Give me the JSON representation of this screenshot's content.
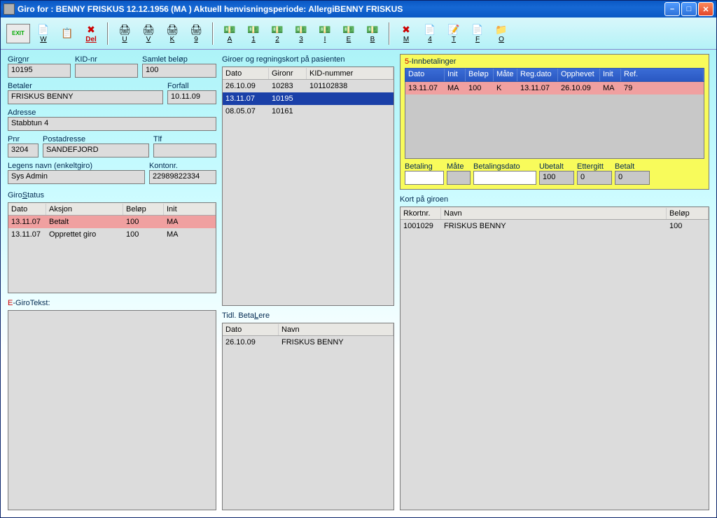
{
  "title": "Giro for :   BENNY FRISKUS 12.12.1956 (MA  )   Aktuell henvisningsperiode: AllergiBENNY FRISKUS",
  "toolbar": {
    "exit": "EXIT",
    "items": [
      "W",
      "",
      "Del",
      "U",
      "V",
      "K",
      "9",
      "A",
      "1",
      "2",
      "3",
      "I",
      "E",
      "B",
      "M",
      "4",
      "T",
      "F",
      "O"
    ]
  },
  "left": {
    "gironr_label": "Gir<u>o</u>nr",
    "gironr": "10195",
    "kid_label": "KID-nr",
    "kid": "",
    "samlet_label": "Samlet beløp",
    "samlet": "100",
    "betaler_label": "Betaler",
    "betaler": "FRISKUS BENNY",
    "forfall_label": "Forfall",
    "forfall": "10.11.09",
    "adresse_label": "Adresse",
    "adresse": "Stabbtun 4",
    "pnr_label": "Pnr",
    "pnr": "3204",
    "post_label": "Postadresse",
    "post": "SANDEFJORD",
    "tlf_label": "Tlf",
    "tlf": "",
    "legens_label": "Legens navn (enkeltgiro)",
    "legens": "Sys Admin",
    "kontonr_label": "Kontonr.",
    "kontonr": "22989822334",
    "girostatus_label": "Giro<u>S</u>tatus",
    "girostatus_head": [
      "Dato",
      "Aksjon",
      "Beløp",
      "Init"
    ],
    "girostatus_rows": [
      {
        "d": "13.11.07",
        "a": "Betalt",
        "b": "100",
        "i": "MA",
        "pink": true
      },
      {
        "d": "13.11.07",
        "a": "Opprettet giro",
        "b": "100",
        "i": "MA",
        "pink": false
      }
    ],
    "egiro_label_pre": "E",
    "egiro_label": "-GiroTekst:"
  },
  "mid": {
    "giroer_label": "Giroer og regningskort på pasienten",
    "giroer_head": [
      "Dato",
      "Gironr",
      "KID-nummer"
    ],
    "giroer_rows": [
      {
        "d": "26.10.09",
        "g": "10283",
        "k": "101102838",
        "sel": false
      },
      {
        "d": "13.11.07",
        "g": "10195",
        "k": "",
        "sel": true
      },
      {
        "d": "08.05.07",
        "g": "10161",
        "k": "",
        "sel": false
      }
    ],
    "tidl_label": "Tidl. Beta<u>L</u>ere",
    "tidl_head": [
      "Dato",
      "Navn"
    ],
    "tidl_rows": [
      {
        "d": "26.10.09",
        "n": "FRISKUS BENNY"
      }
    ]
  },
  "right": {
    "innb_label_pre": "5",
    "innb_label": "-Innbetalinger",
    "innb_head": [
      "Dato",
      "Init",
      "Beløp",
      "Måte",
      "Reg.dato",
      "Opphevet",
      "Init",
      "Ref."
    ],
    "innb_rows": [
      {
        "d": "13.11.07",
        "i": "MA",
        "b": "100",
        "m": "K",
        "r": "13.11.07",
        "o": "26.10.09",
        "i2": "MA",
        "rf": "79"
      }
    ],
    "betaling_label": "Betaling",
    "mate_label": "Måte",
    "betdato_label": "Betalingsdato",
    "ubetalt_label": "Ubetalt",
    "ubetalt": "100",
    "ettergitt_label": "Ettergitt",
    "ettergitt": "0",
    "betalt_label": "Betalt",
    "betalt": "0",
    "kort_label": "Kort på giroen",
    "kort_head": [
      "Rkortnr.",
      "Navn",
      "Beløp"
    ],
    "kort_rows": [
      {
        "r": "1001029",
        "n": "FRISKUS BENNY",
        "b": "100"
      }
    ]
  }
}
